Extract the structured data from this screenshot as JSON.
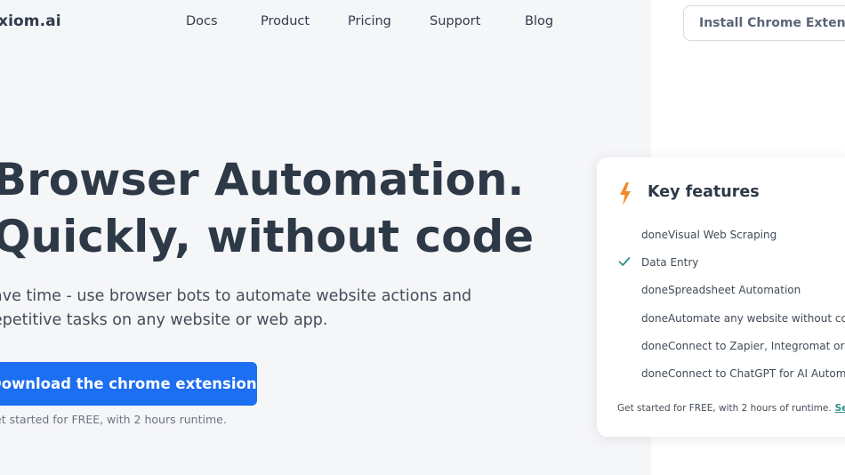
{
  "header": {
    "logo": "xiom.ai",
    "nav": [
      "Docs",
      "Product",
      "Pricing",
      "Support",
      "Blog"
    ],
    "install_button": "Install Chrome Extension"
  },
  "hero": {
    "title_line1": "Browser Automation.",
    "title_line2": "Quickly, without code",
    "subtitle_line1": "ave time - use browser bots to automate website actions and",
    "subtitle_line2": "epetitive tasks on any website or web app.",
    "cta_button": "Download the chrome extension",
    "cta_note": "et started for FREE, with 2 hours runtime."
  },
  "features_card": {
    "title": "Key features",
    "items": [
      "doneVisual Web Scraping",
      "Data Entry",
      "doneSpreadsheet Automation",
      "doneAutomate any website without code",
      "doneConnect to Zapier, Integromat or Webhooks",
      "doneConnect to ChatGPT for AI Automation"
    ],
    "footer_text": "Get started for FREE, with 2 hours of runtime.",
    "footer_link": "See pricing"
  },
  "colors": {
    "primary": "#1c6ef2",
    "accent_orange": "#f4882b",
    "check_teal": "#2f8f8a",
    "heading": "#2e3947"
  },
  "icons": {
    "feature_card": "lightning-bolt-icon",
    "checked_item": "checkmark-icon"
  }
}
